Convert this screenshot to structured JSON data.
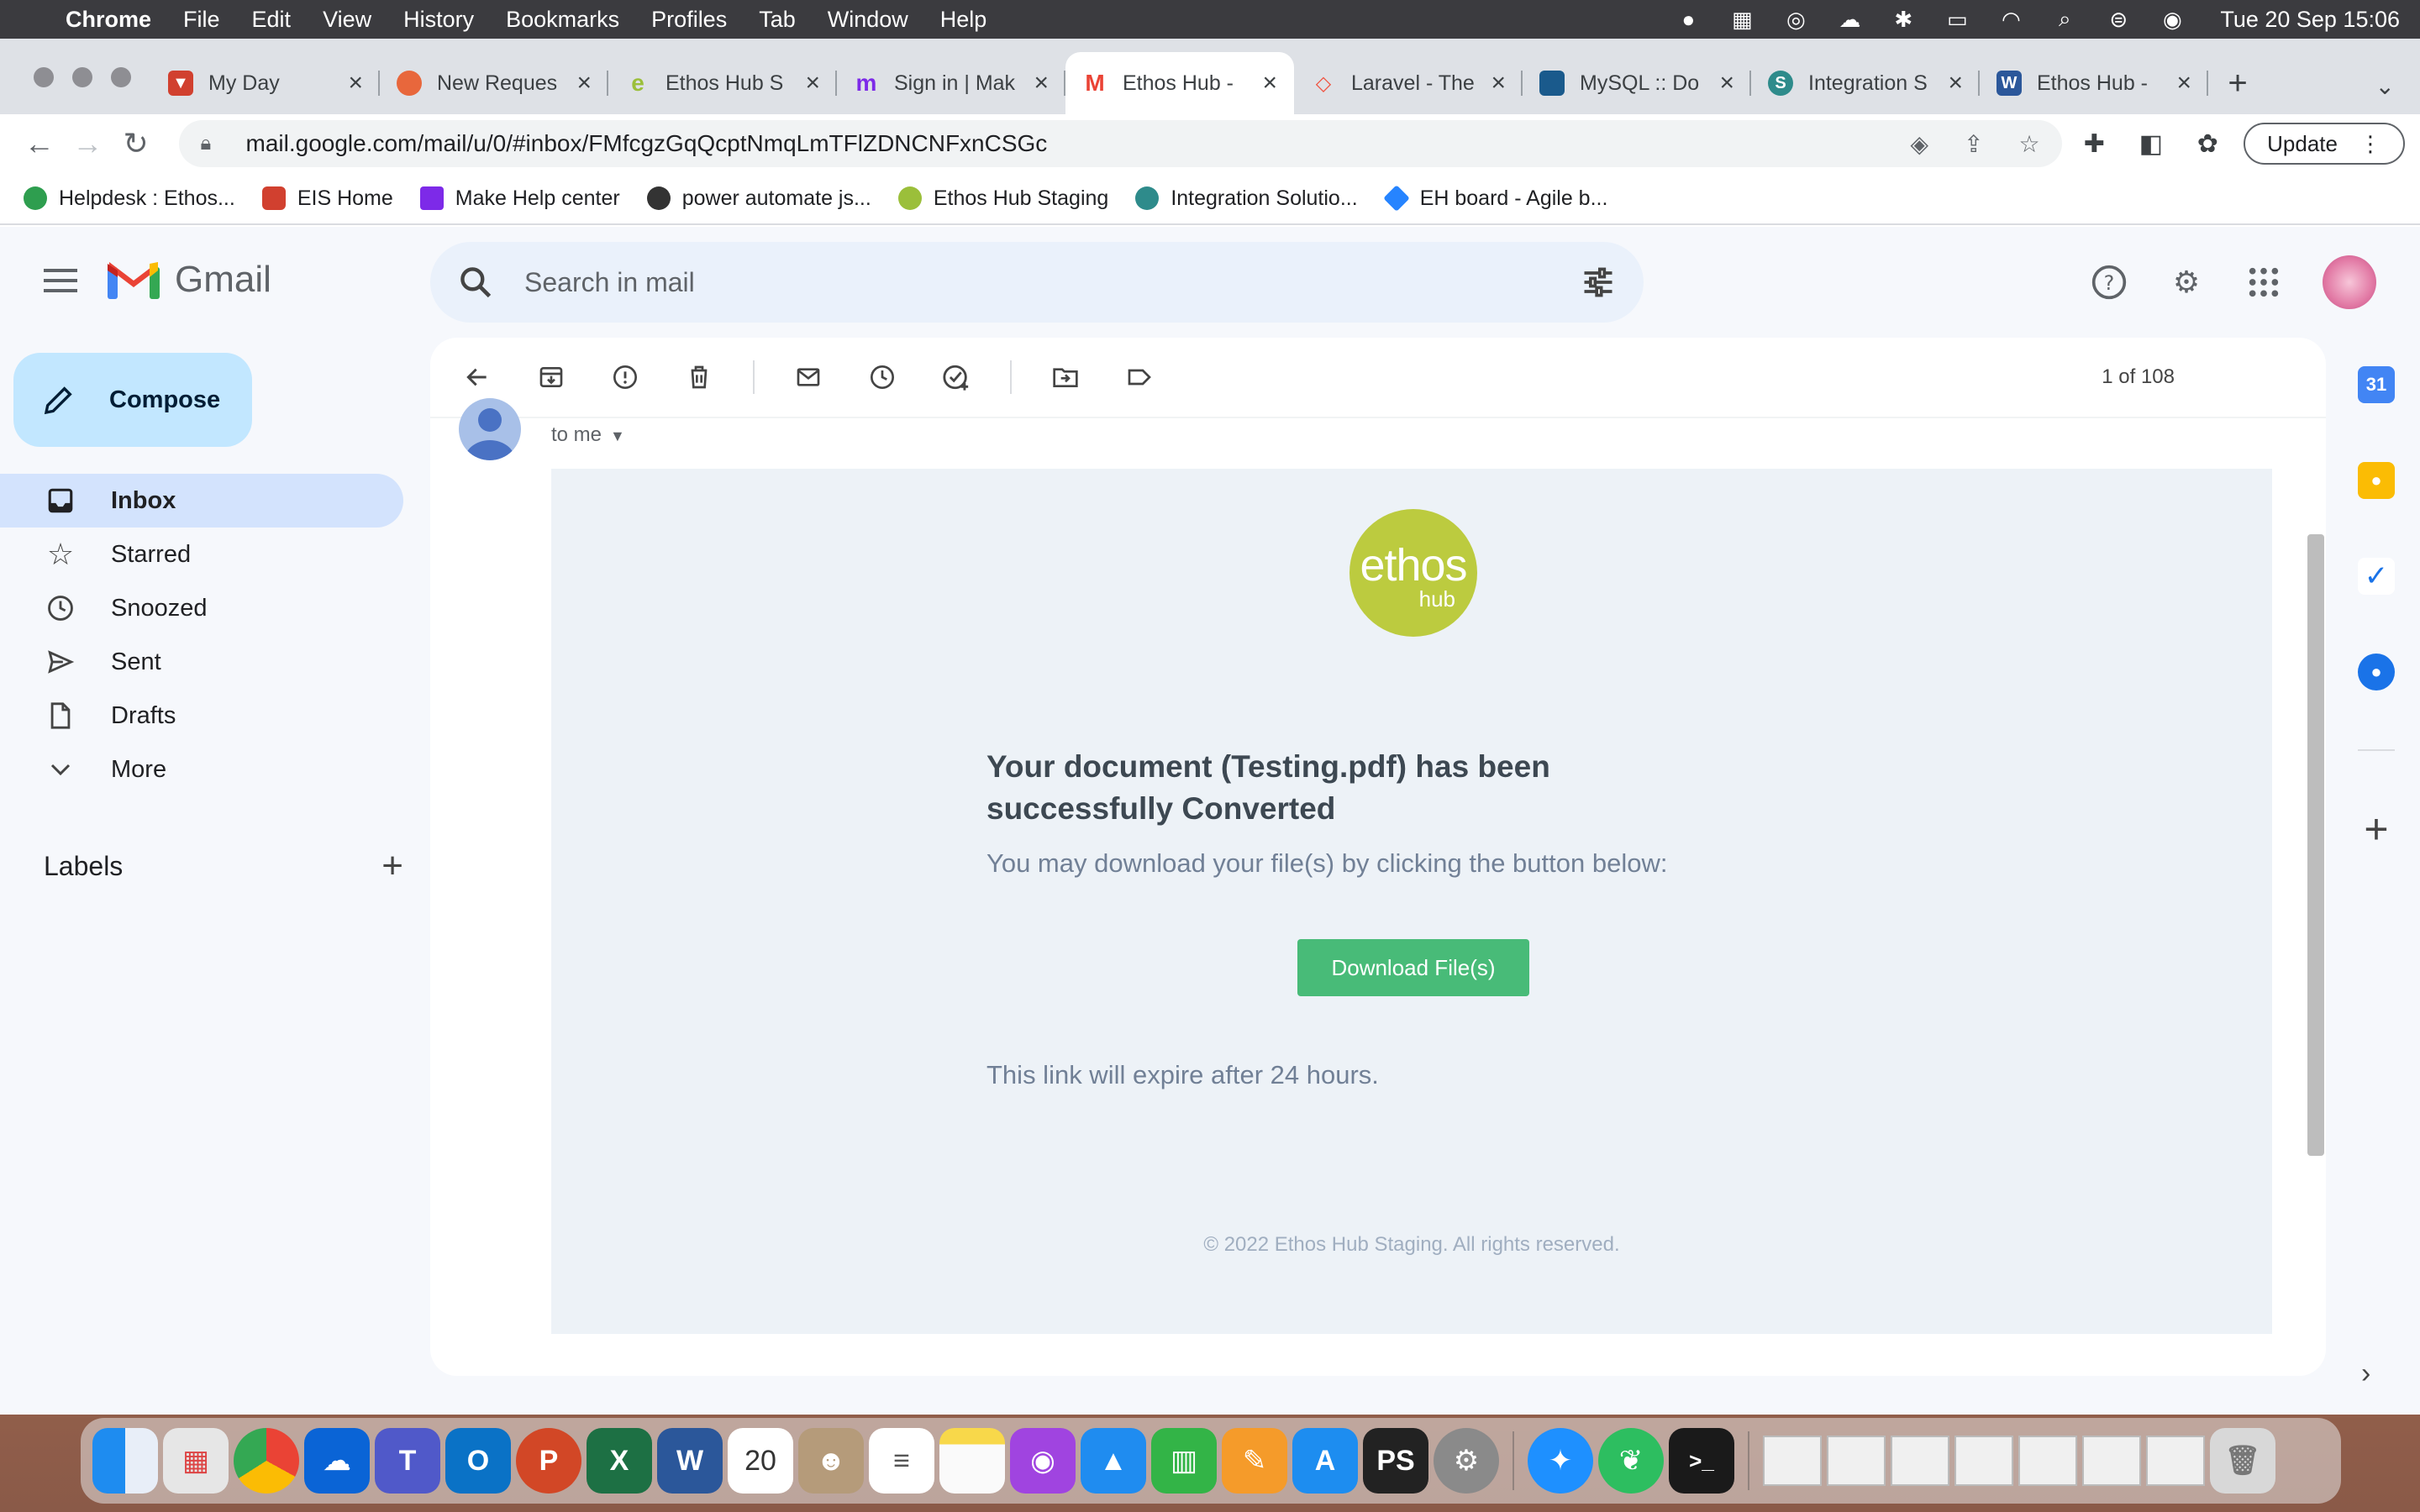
{
  "menubar": {
    "app_name": "Chrome",
    "menus": [
      "File",
      "Edit",
      "View",
      "History",
      "Bookmarks",
      "Profiles",
      "Tab",
      "Window",
      "Help"
    ],
    "clock": "Tue 20 Sep  15:06"
  },
  "tabs": [
    {
      "title": "My Day",
      "color": "#d1402f"
    },
    {
      "title": "New Reques",
      "color": "#e8673c"
    },
    {
      "title": "Ethos Hub S",
      "color": "#9bbf3a"
    },
    {
      "title": "Sign in | Mak",
      "color": "#7d2ae8"
    },
    {
      "title": "Ethos Hub -",
      "color": "#ea4335"
    },
    {
      "title": "Laravel - The",
      "color": "#f05340"
    },
    {
      "title": "MySQL :: Do",
      "color": "#1a5a8c"
    },
    {
      "title": "Integration S",
      "color": "#2e8b8b"
    },
    {
      "title": "Ethos Hub -",
      "color": "#2b579a"
    }
  ],
  "toolbar": {
    "url": "mail.google.com/mail/u/0/#inbox/FMfcgzGqQcptNmqLmTFlZDNCNFxnCSGc",
    "update_label": "Update"
  },
  "bookmarks": [
    {
      "label": "Helpdesk : Ethos...",
      "color": "#2e9e4f"
    },
    {
      "label": "EIS Home",
      "color": "#d1402f"
    },
    {
      "label": "Make Help center",
      "color": "#7d2ae8"
    },
    {
      "label": "power automate js...",
      "color": "#333333"
    },
    {
      "label": "Ethos Hub Staging",
      "color": "#9bbf3a"
    },
    {
      "label": "Integration Solutio...",
      "color": "#2e8b8b"
    },
    {
      "label": "EH board - Agile b...",
      "color": "#2684ff"
    }
  ],
  "gmail": {
    "brand": "Gmail",
    "search_placeholder": "Search in mail",
    "compose_label": "Compose",
    "nav": [
      {
        "label": "Inbox",
        "icon": "inbox-icon",
        "active": true
      },
      {
        "label": "Starred",
        "icon": "star-icon",
        "active": false
      },
      {
        "label": "Snoozed",
        "icon": "clock-icon",
        "active": false
      },
      {
        "label": "Sent",
        "icon": "send-icon",
        "active": false
      },
      {
        "label": "Drafts",
        "icon": "draft-icon",
        "active": false
      },
      {
        "label": "More",
        "icon": "chevron-down-icon",
        "active": false
      }
    ],
    "labels_heading": "Labels",
    "pager": "1 of 108",
    "recipient": "to me"
  },
  "email": {
    "logo_main": "ethos",
    "logo_sub": "hub",
    "headline": "Your document (Testing.pdf) has been successfully Converted",
    "paragraph": "You may download your file(s) by clicking the button below:",
    "button_label": "Download File(s)",
    "expire_note": "This link will expire after 24 hours.",
    "footer": "© 2022 Ethos Hub Staging. All rights reserved."
  },
  "colors": {
    "accent_green": "#48bb78",
    "ethos_logo": "#bccb3f",
    "inbox_active_bg": "#d3e3fd",
    "compose_bg": "#c2e7ff"
  }
}
